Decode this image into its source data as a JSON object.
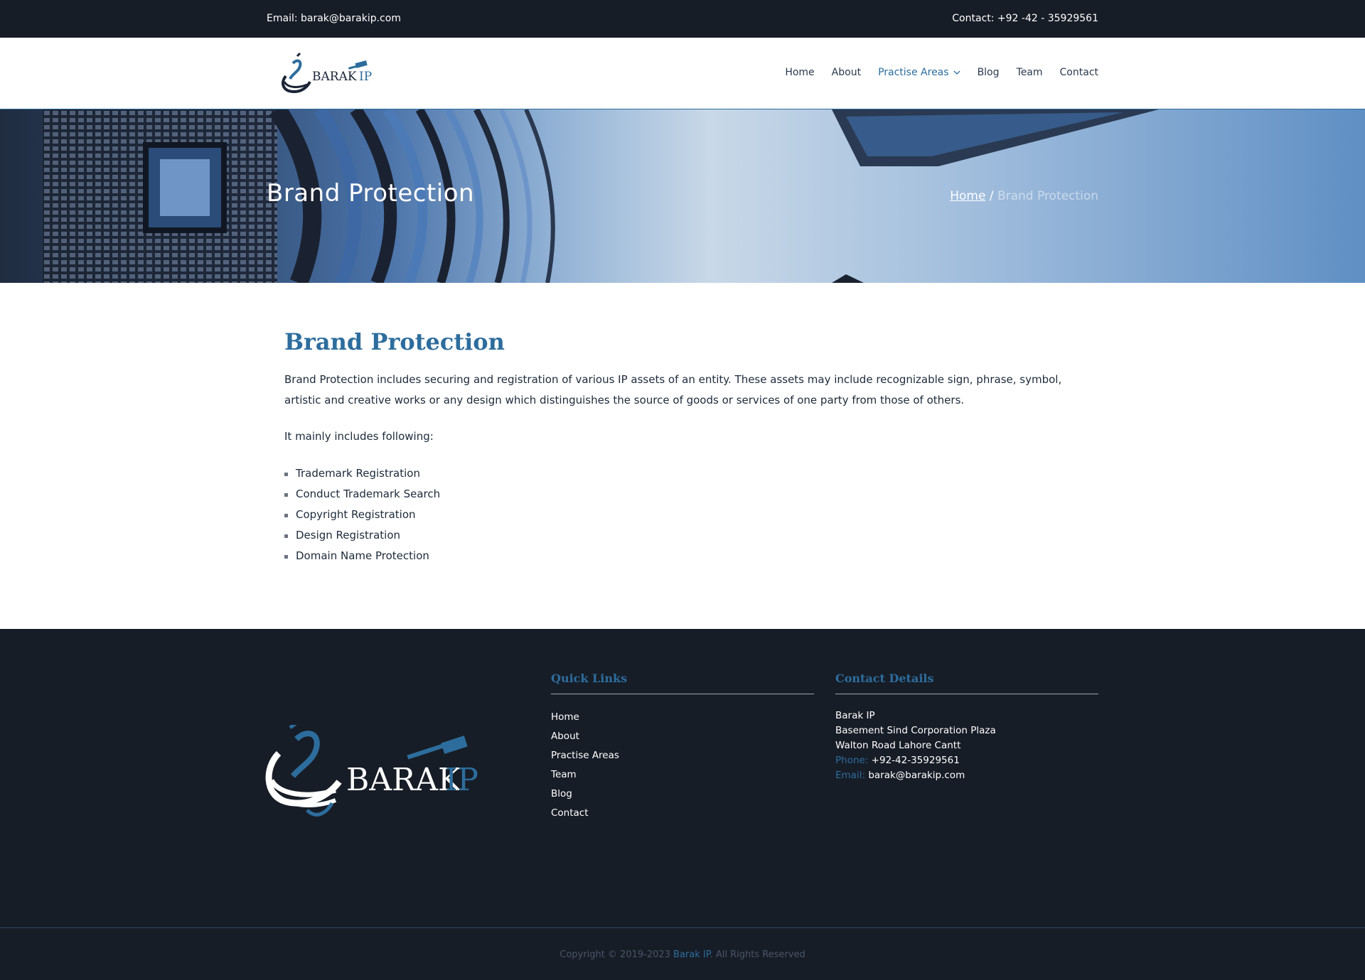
{
  "topbar": {
    "email": "Email: barak@barakip.com",
    "contact": "Contact:  +92 -42 - 35929561"
  },
  "header": {
    "logo_text": "BARAK IP",
    "nav": [
      {
        "label": "Home"
      },
      {
        "label": "About"
      },
      {
        "label": "Practise Areas"
      },
      {
        "label": "Blog"
      },
      {
        "label": "Team"
      },
      {
        "label": "Contact"
      }
    ]
  },
  "banner": {
    "title": "Brand Protection",
    "breadcrumb": {
      "home": "Home",
      "sep": " / ",
      "current": "Brand Protection"
    }
  },
  "content": {
    "heading": "Brand Protection",
    "paragraph": "Brand Protection includes securing and registration of various IP assets of an entity. These assets may include recognizable sign, phrase, symbol, artistic and creative works or any design which distinguishes the source of goods or services of one party from those of others.",
    "intro": "It mainly includes following:",
    "items": [
      "Trademark Registration",
      "Conduct Trademark Search",
      "Copyright Registration",
      "Design Registration",
      "Domain Name Protection"
    ]
  },
  "footer": {
    "logo_text": "BARAK IP",
    "quick_links_title": "Quick Links",
    "quick_links": [
      "Home",
      "About",
      "Practise Areas",
      "Team",
      "Blog",
      "Contact"
    ],
    "contact_title": "Contact Details",
    "address": [
      "Barak IP",
      "Basement Sind Corporation Plaza",
      "Walton Road Lahore Cantt"
    ],
    "phone_label": "Phone:",
    "phone": "+92-42-35929561",
    "email_label": "Email:",
    "email": "barak@barakip.com",
    "copyright_pre": "Copyright © 2019-2023 ",
    "copyright_brand": "Barak IP",
    "copyright_post": ". All Rights Reserved"
  },
  "colors": {
    "accent": "#2d6d9d",
    "dark": "#171d27"
  }
}
